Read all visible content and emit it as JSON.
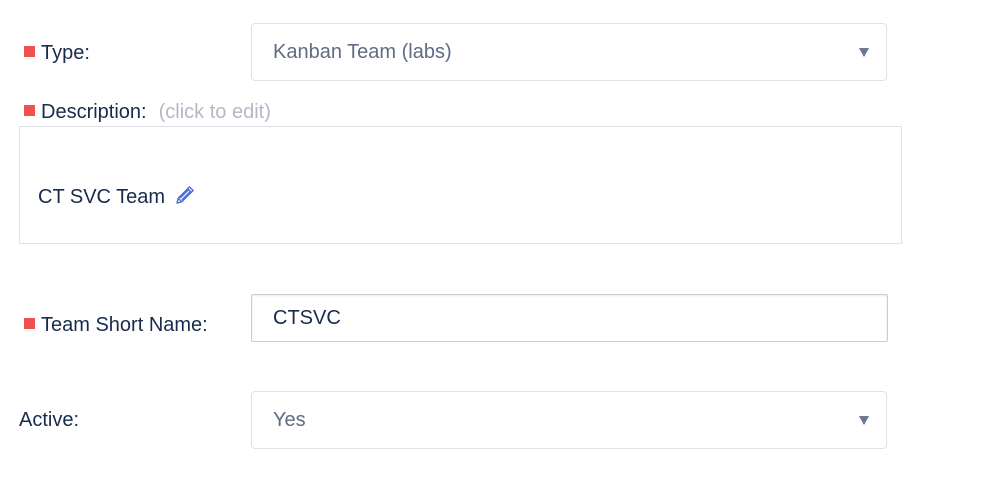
{
  "fields": {
    "type": {
      "label": "Type:",
      "required": true,
      "value": "Kanban Team (labs)"
    },
    "description": {
      "label": "Description:",
      "hint": "(click to edit)",
      "required": true,
      "value": "CT SVC Team",
      "edit_icon": "pencil-icon"
    },
    "short_name": {
      "label": "Team Short Name:",
      "required": true,
      "value": "CTSVC"
    },
    "active": {
      "label": "Active:",
      "required": false,
      "value": "Yes"
    }
  },
  "colors": {
    "required_marker": "#f15050",
    "text": "#172b4d",
    "hint": "#b3b9c4",
    "border": "#dfe1e6"
  }
}
